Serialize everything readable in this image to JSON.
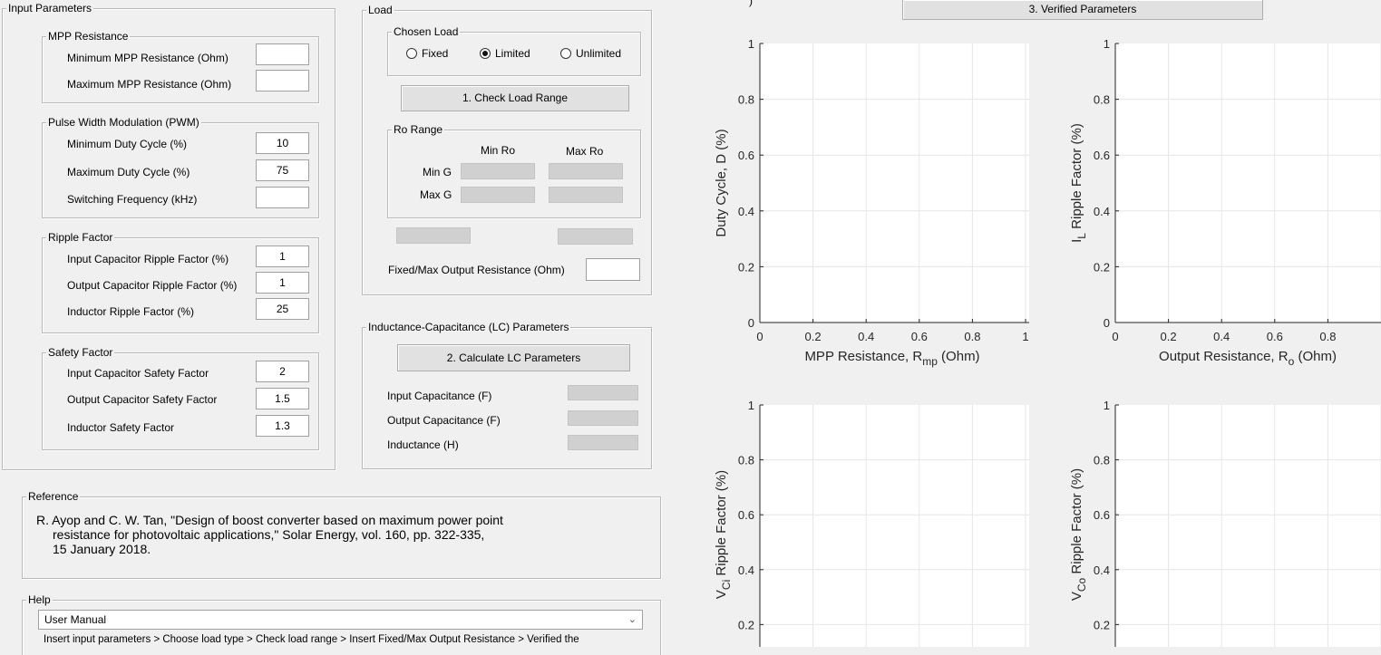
{
  "input_params": {
    "title": "Input Parameters",
    "mpp": {
      "title": "MPP Resistance",
      "min_label": "Minimum MPP Resistance (Ohm)",
      "min_value": "",
      "max_label": "Maximum MPP Resistance (Ohm)",
      "max_value": ""
    },
    "pwm": {
      "title": "Pulse Width Modulation (PWM)",
      "min_duty_label": "Minimum Duty Cycle (%)",
      "min_duty_value": "10",
      "max_duty_label": "Maximum  Duty Cycle (%)",
      "max_duty_value": "75",
      "freq_label": "Switching Frequency (kHz)",
      "freq_value": ""
    },
    "ripple": {
      "title": "Ripple Factor",
      "in_cap_label": "Input Capacitor Ripple Factor (%)",
      "in_cap_value": "1",
      "out_cap_label": "Output Capacitor Ripple Factor (%)",
      "out_cap_value": "1",
      "ind_label": "Inductor Ripple Factor (%)",
      "ind_value": "25"
    },
    "safety": {
      "title": "Safety Factor",
      "in_cap_label": "Input Capacitor Safety Factor",
      "in_cap_value": "2",
      "out_cap_label": "Output Capacitor Safety Factor",
      "out_cap_value": "1.5",
      "ind_label": "Inductor Safety Factor",
      "ind_value": "1.3"
    }
  },
  "load": {
    "title": "Load",
    "chosen_title": "Chosen Load",
    "options": [
      "Fixed",
      "Limited",
      "Unlimited"
    ],
    "selected": "Limited",
    "check_button": "1.  Check Load Range",
    "ro_range": {
      "title": "Ro Range",
      "col_min": "Min Ro",
      "col_max": "Max Ro",
      "row_min": "Min G",
      "row_max": "Max G"
    },
    "fixed_max_label": "Fixed/Max Output Resistance (Ohm)",
    "fixed_max_value": ""
  },
  "lc": {
    "title": "Inductance-Capacitance (LC) Parameters",
    "calc_button": "2.  Calculate LC Parameters",
    "input_cap_label": "Input Capacitance (F)",
    "output_cap_label": "Output Capacitance (F)",
    "inductance_label": "Inductance (H)"
  },
  "reference": {
    "title": "Reference",
    "line1": "R. Ayop and C. W. Tan, \"Design of boost converter based on maximum power point",
    "line2": "resistance for photovoltaic applications,\" Solar Energy, vol. 160, pp. 322-335,",
    "line3": "15 January 2018."
  },
  "help": {
    "title": "Help",
    "selected": "User Manual",
    "text": "Insert input parameters > Choose load type > Check load range > Insert Fixed/Max Output Resistance > Verified the"
  },
  "verified_button": "3.  Verified Parameters",
  "chart_data": [
    {
      "type": "line",
      "xlabel_main": "MPP Resistance, R",
      "xlabel_sub": "mp",
      "xlabel_tail": " (Ohm)",
      "ylabel": "Duty Cycle, D (%)",
      "xlim": [
        0,
        1
      ],
      "ylim": [
        0,
        1
      ],
      "xticks": [
        "0",
        "0.2",
        "0.4",
        "0.6",
        "0.8",
        "1"
      ],
      "yticks": [
        "0",
        "0.2",
        "0.4",
        "0.6",
        "0.8",
        "1"
      ],
      "grid": true,
      "series": []
    },
    {
      "type": "line",
      "xlabel_main": "Output Resistance, R",
      "xlabel_sub": "o",
      "xlabel_tail": " (Ohm)",
      "ylabel_main": "I",
      "ylabel_sub": "L",
      "ylabel_tail": " Ripple Factor (%)",
      "xlim": [
        0,
        1
      ],
      "ylim": [
        0,
        1
      ],
      "xticks": [
        "0",
        "0.2",
        "0.4",
        "0.6",
        "0.8"
      ],
      "yticks": [
        "0",
        "0.2",
        "0.4",
        "0.6",
        "0.8",
        "1"
      ],
      "grid": true,
      "series": []
    },
    {
      "type": "line",
      "ylabel_main": "V",
      "ylabel_sub": "Ci",
      "ylabel_tail": " Ripple Factor (%)",
      "ylim": [
        0,
        1
      ],
      "yticks": [
        "0.2",
        "0.4",
        "0.6",
        "0.8",
        "1"
      ],
      "grid": true,
      "series": []
    },
    {
      "type": "line",
      "ylabel_main": "V",
      "ylabel_sub": "Co",
      "ylabel_tail": " Ripple Factor (%)",
      "ylim": [
        0,
        1
      ],
      "yticks": [
        "0.2",
        "0.4",
        "0.6",
        "0.8",
        "1"
      ],
      "grid": true,
      "series": []
    }
  ]
}
